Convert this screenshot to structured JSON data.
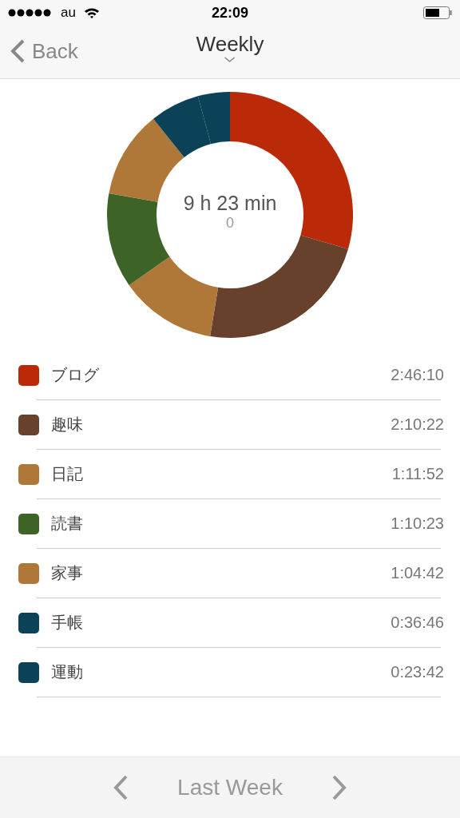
{
  "status_bar": {
    "carrier": "au",
    "time": "22:09"
  },
  "nav": {
    "back": "Back",
    "title": "Weekly"
  },
  "summary": {
    "total": "9 h 23 min",
    "subtitle": "0"
  },
  "chart_data": {
    "type": "donut",
    "values": [
      29.47,
      23.12,
      12.74,
      12.48,
      11.47,
      6.52,
      4.2
    ]
  },
  "legend": [
    {
      "name": "ブログ",
      "time": "2:46:10",
      "color": "#bb2a08"
    },
    {
      "name": "趣味",
      "time": "2:10:22",
      "color": "#67412c"
    },
    {
      "name": "日記",
      "time": "1:11:52",
      "color": "#b07838"
    },
    {
      "name": "読書",
      "time": "1:10:23",
      "color": "#3d6426"
    },
    {
      "name": "家事",
      "time": "1:04:42",
      "color": "#b07838"
    },
    {
      "name": "手帳",
      "time": "0:36:46",
      "color": "#0c4258"
    },
    {
      "name": "運動",
      "time": "0:23:42",
      "color": "#0c4258"
    }
  ],
  "footer": {
    "label": "Last Week"
  }
}
